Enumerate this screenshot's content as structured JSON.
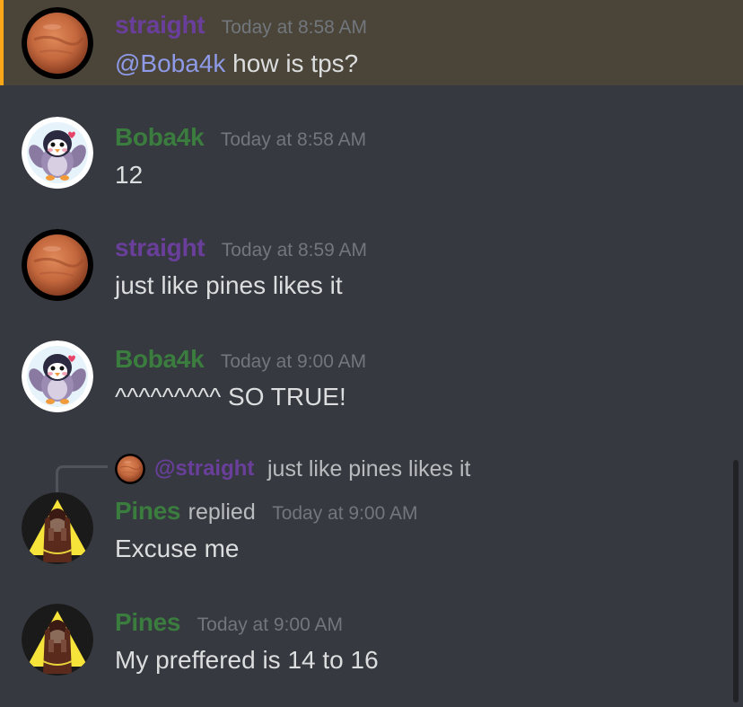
{
  "colors": {
    "background": "#36393f",
    "mention_highlight": "#4a4538",
    "mention_bar": "#faa81a",
    "straight": "#6a3f9c",
    "boba": "#3b7d3e",
    "pines": "#3b7d3e",
    "mention_text": "#8e9ae8",
    "timestamp": "#72767d",
    "message_text": "#dcddde"
  },
  "messages": [
    {
      "username": "straight",
      "timestamp": "Today at 8:58 AM",
      "mention": "@Boba4k",
      "text": " how is tps?",
      "avatar": "mars-avatar-icon"
    },
    {
      "username": "Boba4k",
      "timestamp": "Today at 8:58 AM",
      "text": "12",
      "avatar": "penguin-avatar-icon"
    },
    {
      "username": "straight",
      "timestamp": "Today at 8:59 AM",
      "text": "just like pines likes it",
      "avatar": "mars-avatar-icon"
    },
    {
      "username": "Boba4k",
      "timestamp": "Today at 9:00 AM",
      "text": "^^^^^^^^^ SO TRUE!",
      "avatar": "penguin-avatar-icon"
    },
    {
      "username": "Pines",
      "replied": "replied",
      "timestamp": "Today at 9:00 AM",
      "text": "Excuse me",
      "avatar": "pines-avatar-icon",
      "reply_to": {
        "user": "@straight",
        "text": "just like pines likes it"
      }
    },
    {
      "username": "Pines",
      "timestamp": "Today at 9:00 AM",
      "text": "My preffered is 14 to 16",
      "avatar": "pines-avatar-icon"
    }
  ]
}
